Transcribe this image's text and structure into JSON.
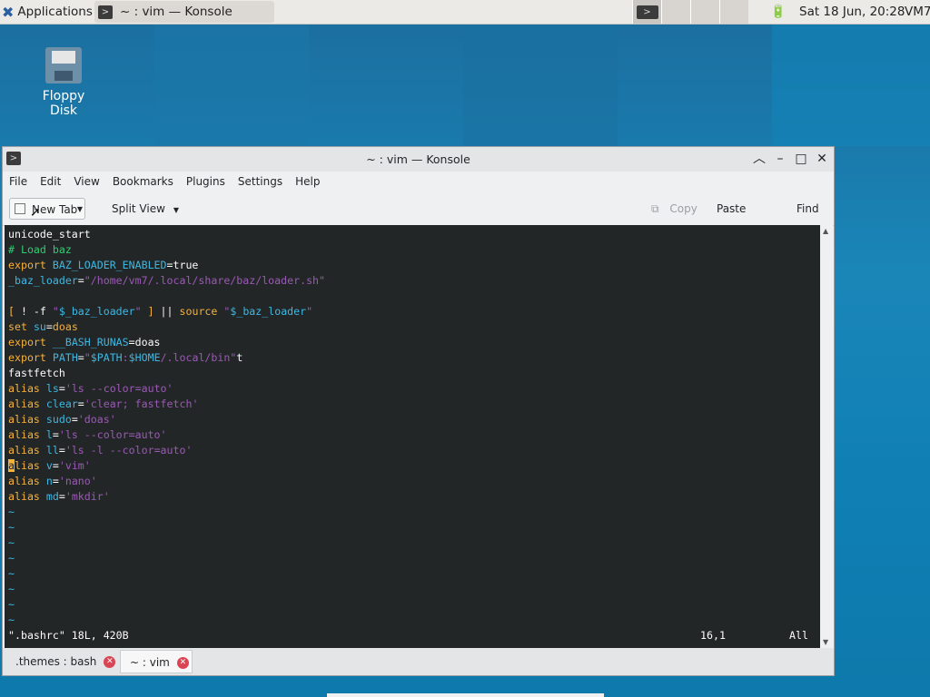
{
  "panel": {
    "apps_label": "Applications",
    "task_title": "~ : vim — Konsole",
    "clock": "Sat 18 Jun, 20:28",
    "user": "VM7"
  },
  "desktop": {
    "floppy_label": "Floppy Disk"
  },
  "window": {
    "title": "~ : vim — Konsole",
    "menu": [
      "File",
      "Edit",
      "View",
      "Bookmarks",
      "Plugins",
      "Settings",
      "Help"
    ],
    "toolbar": {
      "new_tab": "New Tab",
      "split_view": "Split View",
      "copy": "Copy",
      "paste": "Paste",
      "find": "Find"
    }
  },
  "editor": {
    "lines": [
      "unicode_start",
      "# Load baz",
      "export BAZ_LOADER_ENABLED=true",
      "_baz_loader=\"/home/vm7/.local/share/baz/loader.sh\"",
      "",
      "[ ! -f \"$_baz_loader\" ] || source \"$_baz_loader\"",
      "set su=doas",
      "export __BASH_RUNAS=doas",
      "export PATH=\"$PATH:$HOME/.local/bin\"t",
      "fastfetch",
      "alias ls='ls --color=auto'",
      "alias clear='clear; fastfetch'",
      "alias sudo='doas'",
      "alias l='ls --color=auto'",
      "alias ll='ls -l --color=auto'",
      "alias v='vim'",
      "alias n='nano'",
      "alias md='mkdir'"
    ],
    "tilde": "~",
    "status_file": "\".bashrc\" 18L, 420B",
    "status_pos": "16,1",
    "status_all": "All"
  },
  "tabs": [
    {
      "label": ".themes : bash"
    },
    {
      "label": "~ : vim"
    }
  ],
  "colors": {
    "keyword": "#f6b13b",
    "variable": "#3db8e3",
    "string": "#9b59b6",
    "comment": "#2ecc71",
    "terminal_bg": "#232627"
  }
}
